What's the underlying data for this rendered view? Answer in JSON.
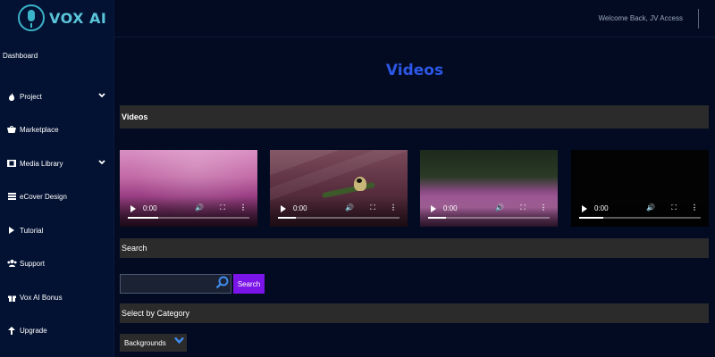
{
  "app": {
    "logo_text": "VOX AI"
  },
  "header": {
    "welcome": "Welcome Back, JV Access"
  },
  "sidebar": {
    "items": [
      {
        "label": "Dashboard",
        "icon": ""
      },
      {
        "label": "Project",
        "icon": "fire-icon",
        "has_chevron": true
      },
      {
        "label": "Marketplace",
        "icon": "basket-icon"
      },
      {
        "label": "Media Library",
        "icon": "film-icon",
        "has_chevron": true
      },
      {
        "label": "eCover Design",
        "icon": "list-icon"
      },
      {
        "label": "Tutorial",
        "icon": "play-icon"
      },
      {
        "label": "Support",
        "icon": "users-icon"
      },
      {
        "label": "Vox AI Bonus",
        "icon": "gift-icon"
      },
      {
        "label": "Upgrade",
        "icon": "arrow-up-icon"
      }
    ]
  },
  "main": {
    "title": "Videos",
    "videos_section": "Videos",
    "videos": [
      {
        "time": "0:00",
        "thumb": "flowers",
        "progress": 0.25
      },
      {
        "time": "0:00",
        "thumb": "bird",
        "progress": 0.15
      },
      {
        "time": "0:00",
        "thumb": "field",
        "progress": 0.15
      },
      {
        "time": "0:00",
        "thumb": "black",
        "progress": 0.2
      }
    ],
    "search_section": "Search",
    "search": {
      "value": "",
      "placeholder": "",
      "button": "Search"
    },
    "category_section": "Select by Category",
    "category_select": {
      "selected": "Backgrounds"
    }
  },
  "colors": {
    "background": "#020b22",
    "sidebar": "#031233",
    "title": "#2c57e6",
    "search_button": "#7b14e8",
    "logo": "#5ac4d8"
  }
}
